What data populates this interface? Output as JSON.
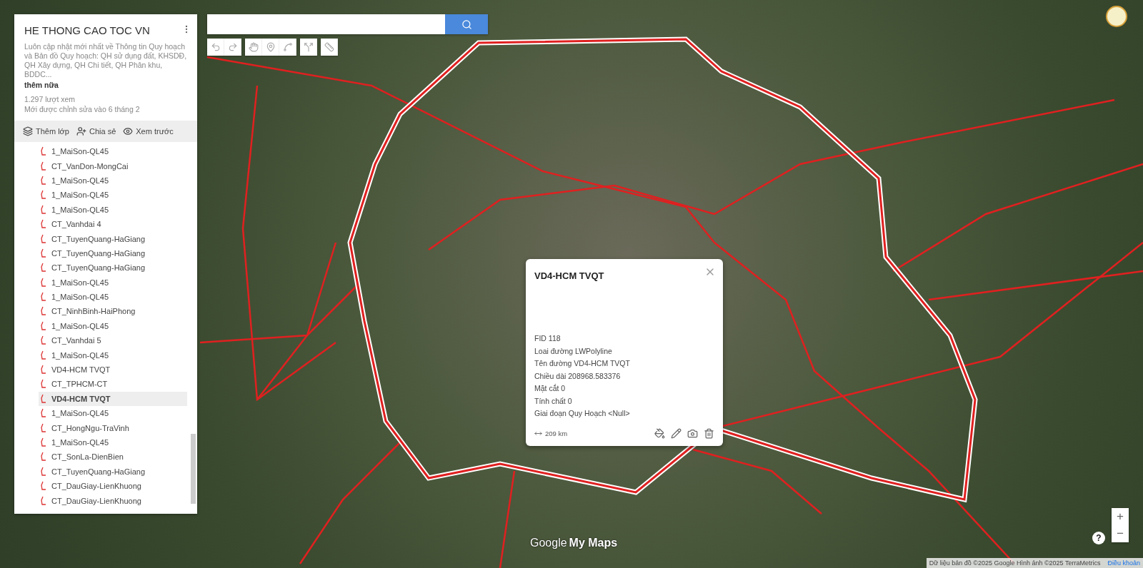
{
  "map": {
    "title": "HE THONG CAO TOC VN",
    "description": "Luôn cập nhật mới nhất về Thông tin Quy hoạch và Bản đồ Quy hoạch: QH sử dụng đất, KHSDĐ, QH Xây dựng, QH Chi tiết, QH Phân khu, BDDC...",
    "more_link": "thêm nữa",
    "views": "1.297 lượt xem",
    "edited": "Mới được chỉnh sửa vào 6 tháng 2"
  },
  "sidebar_actions": [
    {
      "kind": "layer",
      "label": "Thêm lớp"
    },
    {
      "kind": "share",
      "label": "Chia sẻ"
    },
    {
      "kind": "preview",
      "label": "Xem trước"
    }
  ],
  "layers": [
    {
      "label": "1_MaiSon-QL45",
      "selected": false
    },
    {
      "label": "CT_VanDon-MongCai",
      "selected": false
    },
    {
      "label": "1_MaiSon-QL45",
      "selected": false
    },
    {
      "label": "1_MaiSon-QL45",
      "selected": false
    },
    {
      "label": "1_MaiSon-QL45",
      "selected": false
    },
    {
      "label": "CT_Vanhdai 4",
      "selected": false
    },
    {
      "label": "CT_TuyenQuang-HaGiang",
      "selected": false
    },
    {
      "label": "CT_TuyenQuang-HaGiang",
      "selected": false
    },
    {
      "label": "CT_TuyenQuang-HaGiang",
      "selected": false
    },
    {
      "label": "1_MaiSon-QL45",
      "selected": false
    },
    {
      "label": "1_MaiSon-QL45",
      "selected": false
    },
    {
      "label": "CT_NinhBinh-HaiPhong",
      "selected": false
    },
    {
      "label": "1_MaiSon-QL45",
      "selected": false
    },
    {
      "label": "CT_Vanhdai 5",
      "selected": false
    },
    {
      "label": "1_MaiSon-QL45",
      "selected": false
    },
    {
      "label": "VD4-HCM TVQT",
      "selected": false
    },
    {
      "label": "CT_TPHCM-CT",
      "selected": false
    },
    {
      "label": "VD4-HCM TVQT",
      "selected": true
    },
    {
      "label": "1_MaiSon-QL45",
      "selected": false
    },
    {
      "label": "CT_HongNgu-TraVinh",
      "selected": false
    },
    {
      "label": "1_MaiSon-QL45",
      "selected": false
    },
    {
      "label": "CT_SonLa-DienBien",
      "selected": false
    },
    {
      "label": "CT_TuyenQuang-HaGiang",
      "selected": false
    },
    {
      "label": "CT_DauGiay-LienKhuong",
      "selected": false
    },
    {
      "label": "CT_DauGiay-LienKhuong",
      "selected": false
    }
  ],
  "toolbar": [
    {
      "kind": "undo"
    },
    {
      "kind": "redo"
    },
    {
      "kind": "hand"
    },
    {
      "kind": "marker"
    },
    {
      "kind": "line"
    },
    {
      "kind": "route"
    },
    {
      "kind": "ruler"
    }
  ],
  "popup": {
    "title": "VD4-HCM TVQT",
    "fields": [
      "FID 118",
      "Loai đường LWPolyline",
      "Tên đường VD4-HCM TVQT",
      "Chiều dài 208968.583376",
      "Mặt cắt 0",
      "Tính chất 0",
      "Giai đoạn Quy Hoạch <Null>"
    ],
    "length": "209 km"
  },
  "logo": {
    "brand": "Google",
    "product": "My Maps"
  },
  "zoom_controls": [
    "+",
    "−"
  ],
  "help": "?",
  "attribution": "Dữ liệu bản đồ ©2025 Google Hình ảnh ©2025 TerraMetrics",
  "terms_link": "Điều khoản"
}
